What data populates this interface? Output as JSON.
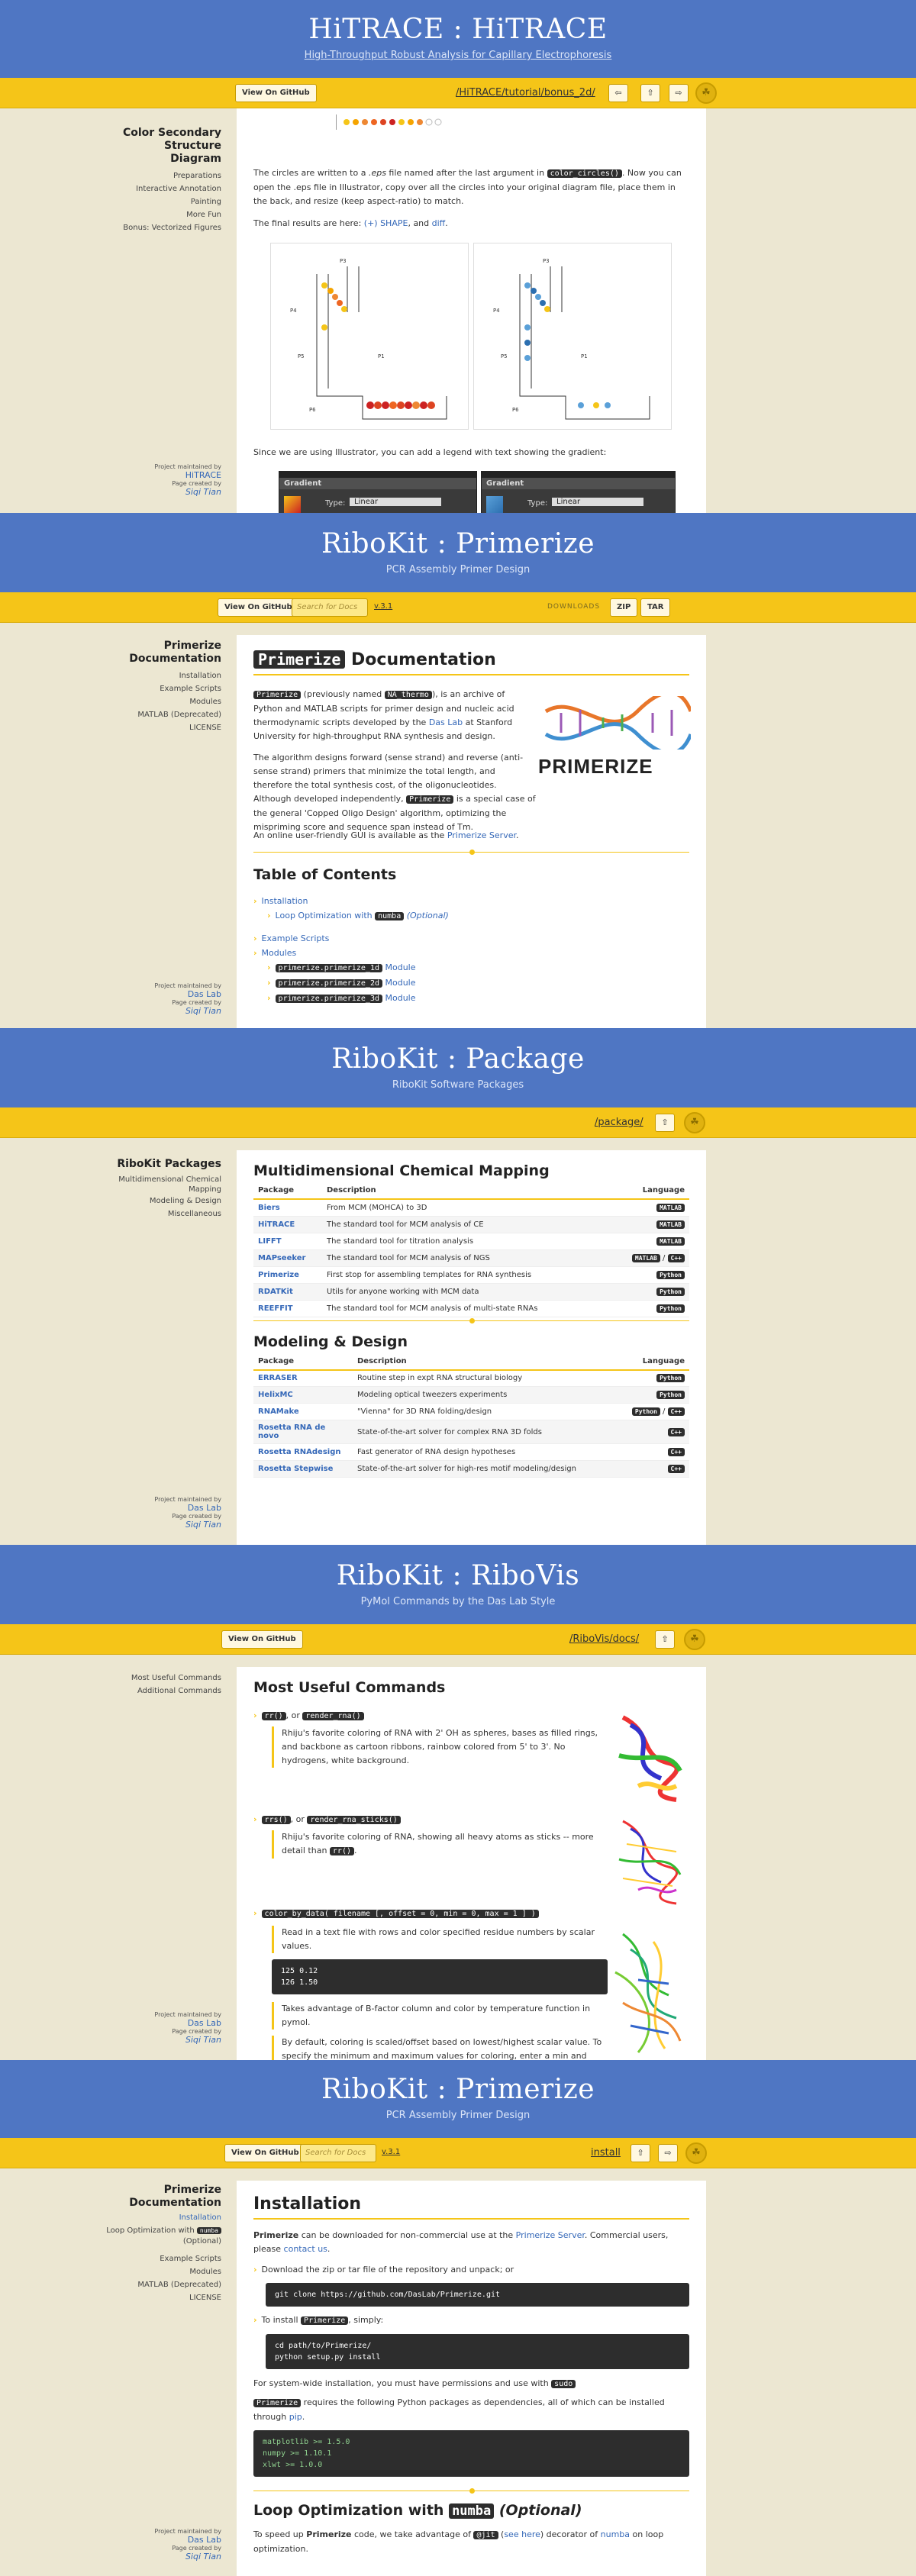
{
  "hitrace": {
    "title": "HiTRACE : HiTRACE",
    "subtitle": "High-Throughput Robust Analysis for Capillary Electrophoresis",
    "view_github": "View On GitHub",
    "path": "/HiTRACE/tutorial/bonus_2d/",
    "nav_left": "⇦",
    "nav_up": "⇧",
    "nav_right": "⇨",
    "sidebar_title": "Color Secondary Structure Diagram",
    "sidebar_items": [
      "Preparations",
      "Interactive Annotation",
      "Painting",
      "More Fun",
      "Bonus: Vectorized Figures"
    ],
    "credit_maint": "Project maintained by",
    "credit_maint_name": "HiTRACE",
    "credit_created": "Page created by",
    "credit_created_name": "Siqi Tian",
    "para1_a": "The circles are written to a ",
    "para1_b": ".eps",
    "para1_c": " file named after the last argument in ",
    "para1_code": "color_circles()",
    "para1_d": ". Now you can open the .eps file in Illustrator, copy over all the circles into your original diagram file, place them in the back, and resize (keep aspect-ratio) to match.",
    "para2_a": "The final results are here: ",
    "para2_link1": "(+) SHAPE",
    "para2_b": ", and ",
    "para2_link2": "diff",
    "para2_c": ".",
    "para3": "Since we are using Illustrator, you can add a legend with text showing the gradient:",
    "gradient_title": "Gradient",
    "gradient_type": "Type:",
    "gradient_value": "Linear"
  },
  "primerize1": {
    "title": "RiboKit : Primerize",
    "subtitle": "PCR Assembly Primer Design",
    "view_github": "View On GitHub",
    "search_placeholder": "Search for Docs",
    "version": "v.3.1",
    "download_label": "DOWNLOADS",
    "zip": "ZIP",
    "tar": "TAR",
    "sidebar_title": "Primerize Documentation",
    "sidebar_items": [
      "Installation",
      "Example Scripts",
      "Modules",
      "MATLAB (Deprecated)",
      "LICENSE"
    ],
    "credit_maint": "Project maintained by",
    "credit_maint_name": "Das Lab",
    "credit_created": "Page created by",
    "credit_created_name": "Siqi Tian",
    "heading_code": "Primerize",
    "heading_text": "Documentation",
    "p1_code": "Primerize",
    "p1_a": " (previously named ",
    "p1_code2": "NA_thermo",
    "p1_b": "), is an archive of Python and MATLAB scripts for primer design and nucleic acid thermodynamic scripts developed by the ",
    "p1_link": "Das Lab",
    "p1_c": " at Stanford University for high-throughput RNA synthesis and design.",
    "p2_a": "The algorithm designs forward (sense strand) and reverse (anti-sense strand) primers that minimize the total length, and therefore the total synthesis cost, of the oligonucleotides. Although developed independently, ",
    "p2_code": "Primerize",
    "p2_b": " is a special case of the general 'Copped Oligo Design' algorithm, optimizing the mispriming score and sequence span instead of Tm.",
    "p3_a": "An online user-friendly GUI is available as the ",
    "p3_link": "Primerize Server",
    "p3_b": ".",
    "logo_text": "PRIMERIZE",
    "toc_title": "Table of Contents",
    "toc": [
      {
        "label": "Installation",
        "indent": 0
      },
      {
        "label": "Loop Optimization with",
        "code": "numba",
        "extra": "(Optional)",
        "indent": 1
      },
      {
        "label": "Example Scripts",
        "indent": 0
      },
      {
        "label": "Modules",
        "indent": 0
      },
      {
        "code": "primerize.primerize_1d",
        "label": "Module",
        "indent": 1
      },
      {
        "code": "primerize.primerize_2d",
        "label": "Module",
        "indent": 1
      },
      {
        "code": "primerize.primerize_3d",
        "label": "Module",
        "indent": 1
      }
    ]
  },
  "package": {
    "title": "RiboKit : Package",
    "subtitle": "RiboKit Software Packages",
    "path": "/package/",
    "nav_up": "⇧",
    "sidebar_title": "RiboKit Packages",
    "sidebar_items": [
      "Multidimensional Chemical Mapping",
      "Modeling & Design",
      "Miscellaneous"
    ],
    "credit_maint": "Project maintained by",
    "credit_maint_name": "Das Lab",
    "credit_created": "Page created by",
    "credit_created_name": "Siqi Tian",
    "section1": "Multidimensional Chemical Mapping",
    "section2": "Modeling & Design",
    "col_package": "Package",
    "col_description": "Description",
    "col_language": "Language",
    "table1": [
      {
        "name": "Biers",
        "desc": "From MCM (MOHCA) to 3D",
        "langs": [
          "MATLAB"
        ]
      },
      {
        "name": "HiTRACE",
        "desc": "The standard tool for MCM analysis of CE",
        "langs": [
          "MATLAB"
        ]
      },
      {
        "name": "LIFFT",
        "desc": "The standard tool for titration analysis",
        "langs": [
          "MATLAB"
        ]
      },
      {
        "name": "MAPseeker",
        "desc": "The standard tool for MCM analysis of NGS",
        "langs": [
          "MATLAB",
          "C++"
        ]
      },
      {
        "name": "Primerize",
        "desc": "First stop for assembling templates for RNA synthesis",
        "langs": [
          "Python"
        ]
      },
      {
        "name": "RDATKit",
        "desc": "Utils for anyone working with MCM data",
        "langs": [
          "Python"
        ]
      },
      {
        "name": "REEFFIT",
        "desc": "The standard tool for MCM analysis of multi-state RNAs",
        "langs": [
          "Python"
        ]
      }
    ],
    "table2": [
      {
        "name": "ERRASER",
        "desc": "Routine step in expt RNA structural biology",
        "langs": [
          "Python"
        ]
      },
      {
        "name": "HelixMC",
        "desc": "Modeling optical tweezers experiments",
        "langs": [
          "Python"
        ]
      },
      {
        "name": "RNAMake",
        "desc": "\"Vienna\" for 3D RNA folding/design",
        "langs": [
          "Python",
          "C++"
        ]
      },
      {
        "name": "Rosetta RNA de novo",
        "desc": "State-of-the-art solver for complex RNA 3D folds",
        "langs": [
          "C++"
        ]
      },
      {
        "name": "Rosetta RNAdesign",
        "desc": "Fast generator of RNA design hypotheses",
        "langs": [
          "C++"
        ]
      },
      {
        "name": "Rosetta Stepwise",
        "desc": "State-of-the-art solver for high-res motif modeling/design",
        "langs": [
          "C++"
        ]
      }
    ]
  },
  "ribovis": {
    "title": "RiboKit : RiboVis",
    "subtitle": "PyMol Commands by the Das Lab Style",
    "view_github": "View On GitHub",
    "path": "/RiboVis/docs/",
    "nav_up": "⇧",
    "sidebar_items": [
      "Most Useful Commands",
      "Additional Commands"
    ],
    "credit_maint": "Project maintained by",
    "credit_maint_name": "Das Lab",
    "credit_created": "Page created by",
    "credit_created_name": "Siqi Tian",
    "heading": "Most Useful Commands",
    "cmd1_a": "rr()",
    "cmd1_or": ", or",
    "cmd1_b": "render_rna()",
    "cmd1_desc": "Rhiju's favorite coloring of RNA with 2' OH as spheres, bases as filled rings, and backbone as cartoon ribbons, rainbow colored from 5' to 3'. No hydrogens, white background.",
    "cmd2_a": "rrs()",
    "cmd2_or": ", or",
    "cmd2_b": "render_rna_sticks()",
    "cmd2_desc_a": "Rhiju's favorite coloring of RNA, showing all heavy atoms as sticks -- more detail than ",
    "cmd2_desc_code": "rr()",
    "cmd2_desc_b": ".",
    "cmd3": "color_by_data( filename [, offset = 0, min = 0, max = 1 ] )",
    "cmd3_desc": "Read in a text file with rows and color specified residue numbers by scalar values.",
    "cmd3_code_lines": [
      "125 0.12",
      "126 1.50"
    ],
    "cmd3_note1": "Takes advantage of B-factor column and color by temperature function in pymol.",
    "cmd3_note2": "By default, coloring is scaled/offset based on lowest/highest scalar value. To specify the minimum and maximum values for coloring, enter a min and max"
  },
  "primerize2": {
    "title": "RiboKit : Primerize",
    "subtitle": "PCR Assembly Primer Design",
    "view_github": "View On GitHub",
    "search_placeholder": "Search for Docs",
    "version": "v.3.1",
    "path": "install",
    "nav_up": "⇧",
    "nav_right": "⇨",
    "sidebar_title": "Primerize Documentation",
    "sidebar_items": [
      "Installation",
      "Loop Optimization with",
      "(Optional)",
      "Example Scripts",
      "Modules",
      "MATLAB (Deprecated)",
      "LICENSE"
    ],
    "sidebar_code": "numba",
    "credit_maint": "Project maintained by",
    "credit_maint_name": "Das Lab",
    "credit_created": "Page created by",
    "credit_created_name": "Siqi Tian",
    "heading": "Installation",
    "p1_a": "Primerize",
    "p1_b": " can be downloaded for non-commercial use at the ",
    "p1_link": "Primerize Server",
    "p1_c": ". Commercial users, please ",
    "p1_link2": "contact us",
    "p1_d": ".",
    "bullet1": "Download the zip or tar file of the repository and unpack; or",
    "code1": "git clone https://github.com/DasLab/Primerize.git",
    "bullet2_a": "To install ",
    "bullet2_code": "Primerize",
    "bullet2_b": ", simply:",
    "code2_lines": [
      "cd path/to/Primerize/",
      "python setup.py install"
    ],
    "p2_a": "For system-wide installation, you must have permissions and use with ",
    "p2_code": "sudo",
    "p3_code": "Primerize",
    "p3_a": " requires the following Python packages as dependencies, all of which can be installed through ",
    "p3_link": "pip",
    "p3_b": ".",
    "code3_lines": [
      "matplotlib >= 1.5.0",
      "numpy >= 1.10.1",
      "xlwt >= 1.0.0"
    ],
    "h2_a": "Loop Optimization with",
    "h2_code": "numba",
    "h2_b": "(Optional)",
    "p4_a": "To speed up ",
    "p4_b": "Primerize",
    "p4_c": " code, we take advantage of ",
    "p4_code": "@jit",
    "p4_d": " (",
    "p4_link": "see here",
    "p4_e": ") decorator of ",
    "p4_link2": "numba",
    "p4_f": " on loop optimization."
  },
  "colors": {
    "header_blue": "#4f76c3",
    "bar_yellow": "#f5c518",
    "page_bg": "#ece7d2",
    "link_blue": "#3568b8"
  }
}
